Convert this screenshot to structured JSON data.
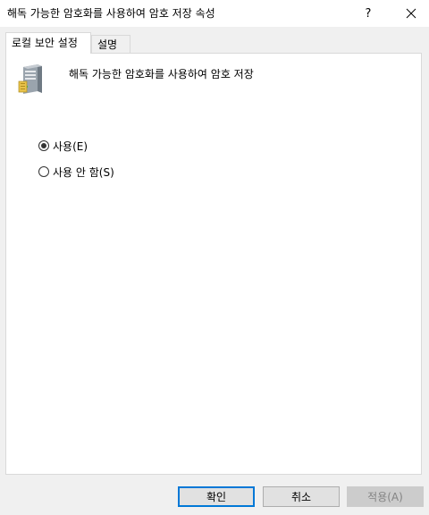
{
  "window": {
    "title": "해독 가능한 암호화를 사용하여 암호 저장 속성",
    "help_label": "?",
    "close_icon": "close-icon"
  },
  "tabs": [
    {
      "label": "로컬 보안 설정",
      "active": true
    },
    {
      "label": "설명",
      "active": false
    }
  ],
  "policy": {
    "icon": "server-icon",
    "name": "해독 가능한 암호화를 사용하여 암호 저장"
  },
  "options": {
    "enable_label": "사용(E)",
    "disable_label": "사용 안 함(S)",
    "selected": "enable"
  },
  "buttons": {
    "ok_label": "확인",
    "cancel_label": "취소",
    "apply_label": "적용(A)",
    "apply_enabled": false
  },
  "colors": {
    "window_bg": "#f0f0f0",
    "panel_bg": "#ffffff",
    "accent": "#0078d7",
    "disabled_text": "#838383"
  }
}
